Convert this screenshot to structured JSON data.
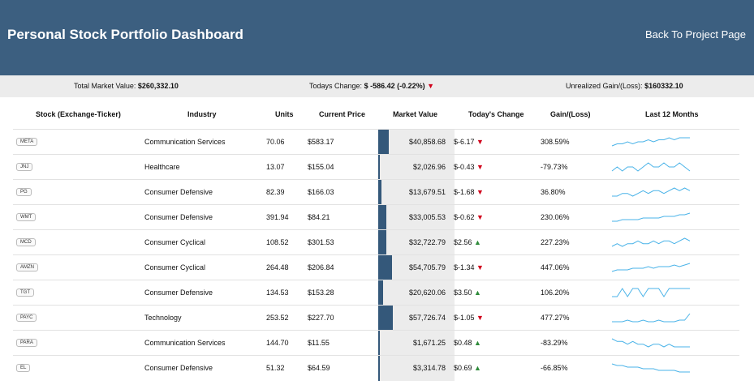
{
  "header": {
    "title": "Personal Stock Portfolio Dashboard",
    "back_link": "Back To Project Page"
  },
  "summary": {
    "total_label": "Total Market Value:",
    "total_value": "$260,332.10",
    "change_label": "Todays Change:",
    "change_value": "$ -586.42 (-0.22%)",
    "change_direction": "down",
    "unrealized_label": "Unrealized Gain/(Loss):",
    "unrealized_value": "$160332.10"
  },
  "colors": {
    "header": "#3c5f80",
    "bar": "#34587a",
    "down": "#d0021b",
    "up": "#2e8b3a",
    "sparkline": "#4ab3e8"
  },
  "table": {
    "columns": [
      "Stock (Exchange-Ticker)",
      "Industry",
      "Units",
      "Current Price",
      "Market Value",
      "Today's Change",
      "Gain/(Loss)",
      "Last 12 Months"
    ],
    "rows": [
      {
        "ticker": "META",
        "industry": "Communication Services",
        "units": "70.06",
        "price": "$583.17",
        "market_value": "$40,858.68",
        "mv_fraction": 0.71,
        "change": "$-6.17",
        "direction": "down",
        "gain": "308.59%",
        "trend": [
          2,
          3,
          3,
          4,
          3,
          4,
          4,
          5,
          4,
          5,
          5,
          6,
          5,
          6,
          6,
          6
        ]
      },
      {
        "ticker": "JNJ",
        "industry": "Healthcare",
        "units": "13.07",
        "price": "$155.04",
        "market_value": "$2,026.96",
        "mv_fraction": 0.04,
        "change": "$-0.43",
        "direction": "down",
        "gain": "-79.73%",
        "trend": [
          4,
          5,
          4,
          5,
          5,
          4,
          5,
          6,
          5,
          5,
          6,
          5,
          5,
          6,
          5,
          4
        ]
      },
      {
        "ticker": "PG",
        "industry": "Consumer Defensive",
        "units": "82.39",
        "price": "$166.03",
        "market_value": "$13,679.51",
        "mv_fraction": 0.24,
        "change": "$-1.68",
        "direction": "down",
        "gain": "36.80%",
        "trend": [
          3,
          3,
          4,
          4,
          3,
          4,
          5,
          4,
          5,
          5,
          4,
          5,
          6,
          5,
          6,
          5
        ]
      },
      {
        "ticker": "WMT",
        "industry": "Consumer Defensive",
        "units": "391.94",
        "price": "$84.21",
        "market_value": "$33,005.53",
        "mv_fraction": 0.57,
        "change": "$-0.62",
        "direction": "down",
        "gain": "230.06%",
        "trend": [
          2,
          2,
          3,
          3,
          3,
          3,
          4,
          4,
          4,
          4,
          5,
          5,
          5,
          6,
          6,
          7
        ]
      },
      {
        "ticker": "MCD",
        "industry": "Consumer Cyclical",
        "units": "108.52",
        "price": "$301.53",
        "market_value": "$32,722.79",
        "mv_fraction": 0.57,
        "change": "$2.56",
        "direction": "up",
        "gain": "227.23%",
        "trend": [
          3,
          4,
          3,
          4,
          4,
          5,
          4,
          4,
          5,
          4,
          5,
          5,
          4,
          5,
          6,
          5
        ]
      },
      {
        "ticker": "AMZN",
        "industry": "Consumer Cyclical",
        "units": "264.48",
        "price": "$206.84",
        "market_value": "$54,705.79",
        "mv_fraction": 0.95,
        "change": "$-1.34",
        "direction": "down",
        "gain": "447.06%",
        "trend": [
          2,
          3,
          3,
          3,
          4,
          4,
          4,
          5,
          4,
          5,
          5,
          5,
          6,
          5,
          6,
          7
        ]
      },
      {
        "ticker": "TGT",
        "industry": "Consumer Defensive",
        "units": "134.53",
        "price": "$153.28",
        "market_value": "$20,620.06",
        "mv_fraction": 0.36,
        "change": "$3.50",
        "direction": "up",
        "gain": "106.20%",
        "trend": [
          4,
          4,
          5,
          4,
          5,
          5,
          4,
          5,
          5,
          5,
          4,
          5,
          5,
          5,
          5,
          5
        ]
      },
      {
        "ticker": "PAYC",
        "industry": "Technology",
        "units": "253.52",
        "price": "$227.70",
        "market_value": "$57,726.74",
        "mv_fraction": 1.0,
        "change": "$-1.05",
        "direction": "down",
        "gain": "477.27%",
        "trend": [
          3,
          3,
          3,
          4,
          3,
          3,
          4,
          3,
          3,
          4,
          3,
          3,
          3,
          4,
          4,
          8
        ]
      },
      {
        "ticker": "PARA",
        "industry": "Communication Services",
        "units": "144.70",
        "price": "$11.55",
        "market_value": "$1,671.25",
        "mv_fraction": 0.03,
        "change": "$0.48",
        "direction": "up",
        "gain": "-83.29%",
        "trend": [
          6,
          5,
          5,
          4,
          5,
          4,
          4,
          3,
          4,
          4,
          3,
          4,
          3,
          3,
          3,
          3
        ]
      },
      {
        "ticker": "EL",
        "industry": "Consumer Defensive",
        "units": "51.32",
        "price": "$64.59",
        "market_value": "$3,314.78",
        "mv_fraction": 0.06,
        "change": "$0.69",
        "direction": "up",
        "gain": "-66.85%",
        "trend": [
          7,
          6,
          6,
          5,
          5,
          5,
          4,
          4,
          4,
          3,
          3,
          3,
          3,
          2,
          2,
          2
        ]
      }
    ]
  }
}
